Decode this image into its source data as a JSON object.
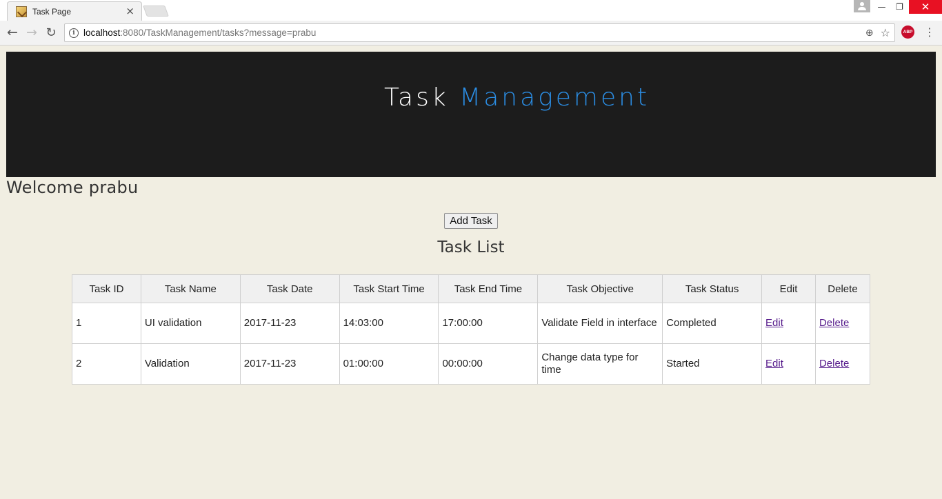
{
  "browser": {
    "tab_title": "Task Page",
    "tab_close": "×",
    "url_host": "localhost",
    "url_rest": ":8080/TaskManagement/tasks?message=prabu",
    "abp_label": "ABP",
    "win_min": "—",
    "win_max": "❐",
    "win_close": "✕",
    "back": "←",
    "forward": "→",
    "reload": "↻",
    "zoom": "⊕",
    "star": "☆",
    "menu": "⋮",
    "info": "i"
  },
  "header": {
    "title_part1": "Task",
    "title_part2": "Management",
    "accent_color": "#2b8de3",
    "background_color": "#1c1c1c"
  },
  "welcome_text": "Welcome prabu",
  "add_task_label": "Add Task",
  "task_list_title": "Task List",
  "table": {
    "columns": [
      "Task ID",
      "Task Name",
      "Task Date",
      "Task Start Time",
      "Task End Time",
      "Task Objective",
      "Task Status",
      "Edit",
      "Delete"
    ],
    "rows": [
      {
        "id": "1",
        "name": "UI validation",
        "date": "2017-11-23",
        "start": "14:03:00",
        "end": "17:00:00",
        "objective": "Validate Field in interface",
        "status": "Completed",
        "edit": "Edit",
        "delete": "Delete"
      },
      {
        "id": "2",
        "name": "Validation",
        "date": "2017-11-23",
        "start": "01:00:00",
        "end": "00:00:00",
        "objective": "Change data type for time",
        "status": "Started",
        "edit": "Edit",
        "delete": "Delete"
      }
    ]
  }
}
